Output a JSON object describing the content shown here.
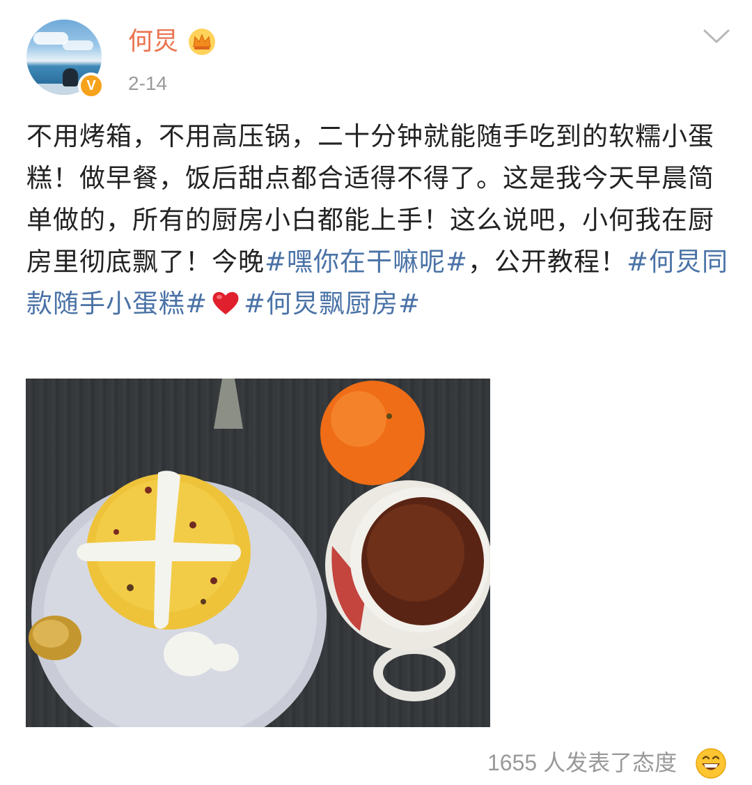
{
  "user": {
    "name": "何炅",
    "date": "2-14",
    "verified_badge": "V",
    "avatar_icon": "avatar-image",
    "crown_icon": "crown-icon"
  },
  "post": {
    "text_1": "不用烤箱，不用高压锅，二十分钟就能随手吃到的软糯小蛋糕！做早餐，饭后甜点都合适得不得了。这是我今天早晨简单做的，所有的厨房小白都能上手！这么说吧，小何我在厨房里彻底飘了！今晚",
    "hashtag_1": "#嘿你在干嘛呢#",
    "text_2": "，公开教程！",
    "hashtag_2": "#何炅同款随手小蛋糕#",
    "hashtag_3": "#何炅飘厨房#",
    "emoji": "heart-icon"
  },
  "footer": {
    "reactions_text": "1655 人发表了态度",
    "reaction_icon": "smile-emoji-icon"
  },
  "colors": {
    "username": "#eb7350",
    "hashtag": "#4a72a6",
    "muted": "#999999",
    "badge": "#f7a21b"
  }
}
